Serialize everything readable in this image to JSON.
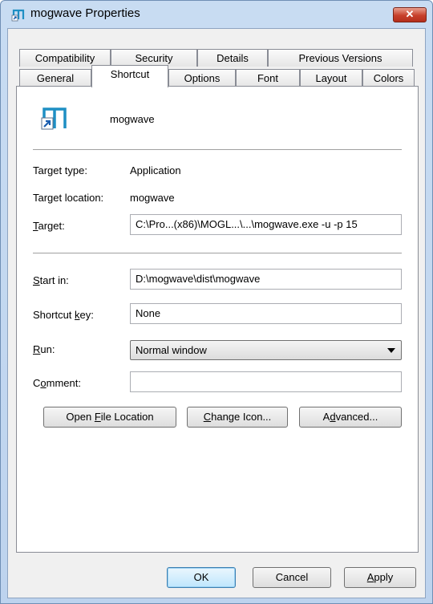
{
  "window": {
    "title": "mogwave Properties",
    "close_label": "✕"
  },
  "tabs_row1": [
    {
      "label": "Compatibility"
    },
    {
      "label": "Security"
    },
    {
      "label": "Details"
    },
    {
      "label": "Previous Versions"
    }
  ],
  "tabs_row2": [
    {
      "label": "General"
    },
    {
      "label": "Shortcut",
      "active": true
    },
    {
      "label": "Options"
    },
    {
      "label": "Font"
    },
    {
      "label": "Layout"
    },
    {
      "label": "Colors"
    }
  ],
  "shortcut": {
    "name": "mogwave",
    "icon": "shortcut-app-icon",
    "target_type_label": "Target type:",
    "target_type_value": "Application",
    "target_location_label": "Target location:",
    "target_location_value": "mogwave",
    "target_label_pre": "",
    "target_label_u": "T",
    "target_label_post": "arget:",
    "target_value": "C:\\Pro...(x86)\\MOGL...\\...\\mogwave.exe -u -p 15",
    "start_in_label_u": "S",
    "start_in_label_post": "tart in:",
    "start_in_value": "D:\\mogwave\\dist\\mogwave",
    "shortcut_key_label_pre": "Shortcut ",
    "shortcut_key_label_u": "k",
    "shortcut_key_label_post": "ey:",
    "shortcut_key_value": "None",
    "run_label_u": "R",
    "run_label_post": "un:",
    "run_value": "Normal window",
    "comment_label_pre": "C",
    "comment_label_u": "o",
    "comment_label_post": "mment:",
    "comment_value": "",
    "open_file_location_pre": "Open ",
    "open_file_location_u": "F",
    "open_file_location_post": "ile Location",
    "change_icon_pre": "",
    "change_icon_u": "C",
    "change_icon_post": "hange Icon...",
    "advanced_pre": "A",
    "advanced_u": "d",
    "advanced_post": "vanced..."
  },
  "footer": {
    "ok_label": "OK",
    "cancel_label": "Cancel",
    "apply_u": "A",
    "apply_post": "pply"
  },
  "colors": {
    "accent": "#1e8fc4",
    "close": "#c7402b"
  }
}
